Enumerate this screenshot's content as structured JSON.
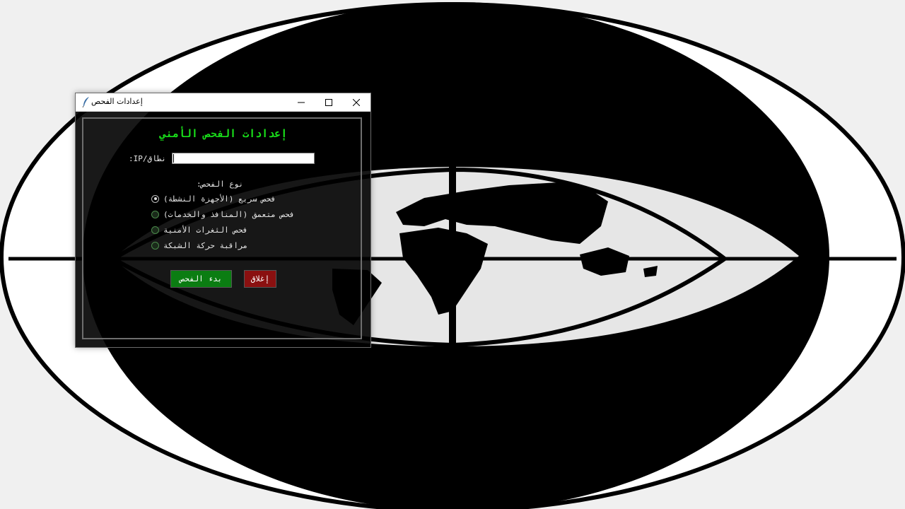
{
  "window": {
    "title": "إعدادات الفحص"
  },
  "dialog": {
    "heading": "إعدادات الفحص الأمني",
    "ip_label": "نطاق/IP:",
    "ip_value": "",
    "scan_type_label": "نوع الفحص:",
    "scan_options": [
      {
        "label": "فحص سريع (الأجهزة النشطة)",
        "checked": true
      },
      {
        "label": "فحص متعمق (المنافذ والخدمات)",
        "checked": false
      },
      {
        "label": "فحص الثغرات الأمنية",
        "checked": false
      },
      {
        "label": "مراقبة حركة الشبكة",
        "checked": false
      }
    ],
    "start_button": "بدء الفحص",
    "close_button": "إغلاق"
  },
  "colors": {
    "heading": "#19e01a",
    "start_button": "#0b7d12",
    "close_button": "#8a1010"
  }
}
